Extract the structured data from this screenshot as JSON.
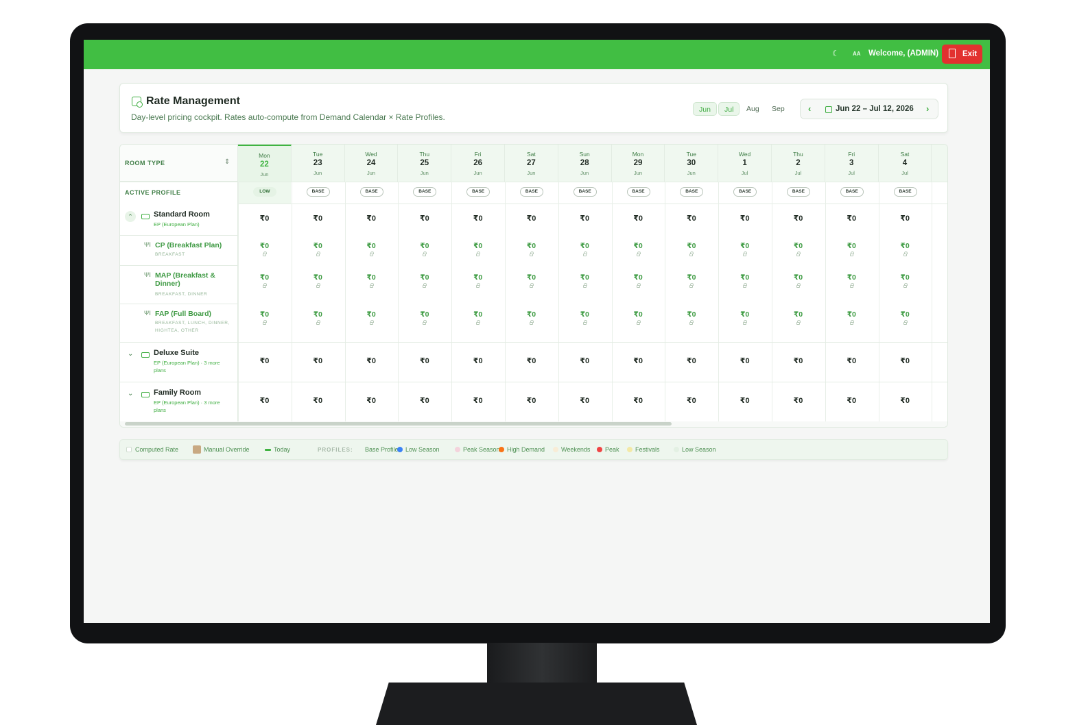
{
  "topbar": {
    "welcome": "Welcome, (ADMIN)",
    "exit_label": "Exit",
    "theme_icon": "moon-icon",
    "font_icon": "font-size-icon",
    "font_glyph": "AA",
    "bg_color": "#41be43",
    "exit_color": "#e2312f"
  },
  "header": {
    "title": "Rate Management",
    "subtitle": "Day-level pricing cockpit. Rates auto-compute from Demand Calendar × Rate Profiles.",
    "months": [
      "Jun",
      "Jul",
      "Aug",
      "Sep"
    ],
    "selected_months": [
      "Jun",
      "Jul"
    ],
    "date_range": "Jun 22 – Jul 12, 2026",
    "prev_glyph": "‹",
    "next_glyph": "›"
  },
  "grid": {
    "room_type_header": "ROOM TYPE",
    "sort_glyph": "⇕",
    "active_profile_header": "ACTIVE PROFILE",
    "days": [
      {
        "dow": "Mon",
        "day": "22",
        "month": "Jun",
        "profile": "LOW",
        "today": true
      },
      {
        "dow": "Tue",
        "day": "23",
        "month": "Jun",
        "profile": "BASE"
      },
      {
        "dow": "Wed",
        "day": "24",
        "month": "Jun",
        "profile": "BASE"
      },
      {
        "dow": "Thu",
        "day": "25",
        "month": "Jun",
        "profile": "BASE"
      },
      {
        "dow": "Fri",
        "day": "26",
        "month": "Jun",
        "profile": "BASE"
      },
      {
        "dow": "Sat",
        "day": "27",
        "month": "Jun",
        "profile": "BASE"
      },
      {
        "dow": "Sun",
        "day": "28",
        "month": "Jun",
        "profile": "BASE"
      },
      {
        "dow": "Mon",
        "day": "29",
        "month": "Jun",
        "profile": "BASE"
      },
      {
        "dow": "Tue",
        "day": "30",
        "month": "Jun",
        "profile": "BASE"
      },
      {
        "dow": "Wed",
        "day": "1",
        "month": "Jul",
        "profile": "BASE"
      },
      {
        "dow": "Thu",
        "day": "2",
        "month": "Jul",
        "profile": "BASE"
      },
      {
        "dow": "Fri",
        "day": "3",
        "month": "Jul",
        "profile": "BASE"
      },
      {
        "dow": "Sat",
        "day": "4",
        "month": "Jul",
        "profile": "BASE"
      }
    ],
    "rows": [
      {
        "kind": "room",
        "name": "Standard Room",
        "sub": "EP (European Plan)",
        "expanded": true,
        "price": "₹0"
      },
      {
        "kind": "plan",
        "name": "CP (Breakfast Plan)",
        "sub": "BREAKFAST",
        "price": "₹0"
      },
      {
        "kind": "plan",
        "name": "MAP (Breakfast & Dinner)",
        "sub": "BREAKFAST, DINNER",
        "price": "₹0"
      },
      {
        "kind": "plan",
        "name": "FAP (Full Board)",
        "sub": "BREAKFAST, LUNCH, DINNER, HIGHTEA, OTHER",
        "price": "₹0"
      },
      {
        "kind": "room",
        "name": "Deluxe Suite",
        "sub": "EP (European Plan) · 3 more plans",
        "expanded": false,
        "price": "₹0"
      },
      {
        "kind": "room",
        "name": "Family Room",
        "sub": "EP (European Plan) · 3 more plans",
        "expanded": false,
        "price": "₹0"
      }
    ]
  },
  "legend": {
    "computed": "Computed Rate",
    "manual": "Manual Override",
    "today": "Today",
    "profiles_label": "PROFILES:",
    "profiles": [
      {
        "name": "Base Profile",
        "color": "#ffffff"
      },
      {
        "name": "Low Season",
        "color": "#3b82f6"
      },
      {
        "name": "Peak Season",
        "color": "#f4d3dc"
      },
      {
        "name": "High Demand",
        "color": "#f97316"
      },
      {
        "name": "Weekends",
        "color": "#f8ecd6"
      },
      {
        "name": "Peak",
        "color": "#ef4444"
      },
      {
        "name": "Festivals",
        "color": "#f3e9a6"
      },
      {
        "name": "Low Season",
        "color": "#e3f0e3"
      }
    ],
    "manual_color": "#c8a982",
    "today_color": "#3fb341"
  }
}
